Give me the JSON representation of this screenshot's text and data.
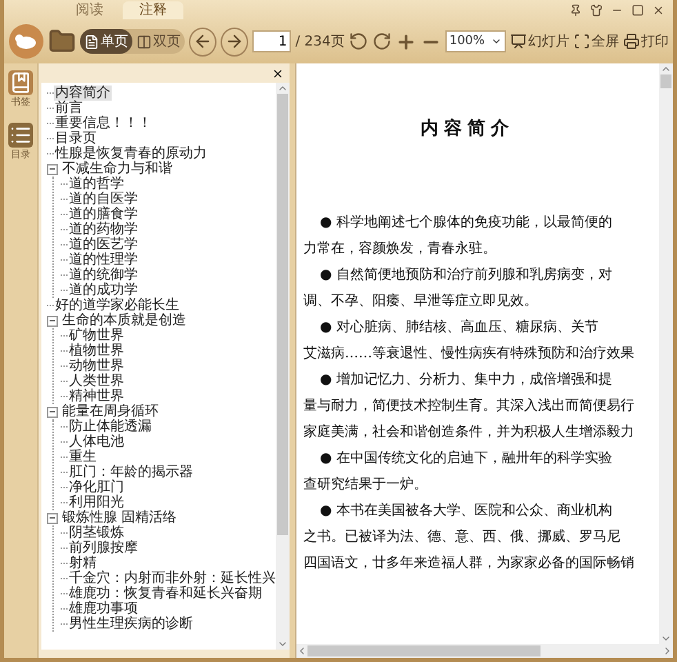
{
  "tabs": [
    {
      "label": "阅读",
      "selected": false
    },
    {
      "label": "注释",
      "selected": true
    }
  ],
  "toolbar": {
    "view_modes": [
      {
        "label": "单页",
        "kind": "single",
        "selected": true
      },
      {
        "label": "双页",
        "kind": "double",
        "selected": false
      }
    ],
    "page_input": {
      "value": "1"
    },
    "page_total": "/ 234页",
    "zoom_select": {
      "value": "100%"
    },
    "actions": [
      {
        "label": "幻灯片",
        "kind": "slideshow"
      },
      {
        "label": "全屏",
        "kind": "fullscreen"
      },
      {
        "label": "打印",
        "kind": "print"
      }
    ]
  },
  "side_rail": [
    {
      "label": "书签",
      "kind": "bookmark",
      "selected": false
    },
    {
      "label": "目录",
      "kind": "toc",
      "selected": true
    }
  ],
  "toc": {
    "items": [
      {
        "label": "内容简介",
        "selected": true
      },
      {
        "label": "前言",
        "selected": false
      },
      {
        "label": "重要信息！！！",
        "selected": false
      },
      {
        "label": "目录页",
        "selected": false
      },
      {
        "label": "性腺是恢复青春的原动力",
        "selected": false
      },
      {
        "label": "不减生命力与和谐",
        "selected": false,
        "expanded": true,
        "children": [
          {
            "label": "道的哲学",
            "selected": false
          },
          {
            "label": "道的自医学",
            "selected": false
          },
          {
            "label": "道的膳食学",
            "selected": false
          },
          {
            "label": "道的药物学",
            "selected": false
          },
          {
            "label": "道的医艺学",
            "selected": false
          },
          {
            "label": "道的性理学",
            "selected": false
          },
          {
            "label": "道的统御学",
            "selected": false
          },
          {
            "label": "道的成功学",
            "selected": false
          }
        ]
      },
      {
        "label": "好的道学家必能长生",
        "selected": false
      },
      {
        "label": "生命的本质就是创造",
        "selected": false,
        "expanded": true,
        "children": [
          {
            "label": "矿物世界",
            "selected": false
          },
          {
            "label": "植物世界",
            "selected": false
          },
          {
            "label": "动物世界",
            "selected": false
          },
          {
            "label": "人类世界",
            "selected": false
          },
          {
            "label": "精神世界",
            "selected": false
          }
        ]
      },
      {
        "label": "能量在周身循环",
        "selected": false,
        "expanded": true,
        "children": [
          {
            "label": "防止体能透漏",
            "selected": false
          },
          {
            "label": "人体电池",
            "selected": false
          },
          {
            "label": "重生",
            "selected": false
          },
          {
            "label": "肛门：年龄的揭示器",
            "selected": false
          },
          {
            "label": "净化肛门",
            "selected": false
          },
          {
            "label": "利用阳光",
            "selected": false
          }
        ]
      },
      {
        "label": "锻炼性腺 固精活络",
        "selected": false,
        "expanded": true,
        "children": [
          {
            "label": "阴茎锻炼",
            "selected": false
          },
          {
            "label": "前列腺按摩",
            "selected": false
          },
          {
            "label": "射精",
            "selected": false
          },
          {
            "label": "千金穴：内射而非外射：延长性兴",
            "selected": false
          },
          {
            "label": "雄鹿功：恢复青春和延长兴奋期",
            "selected": false
          },
          {
            "label": "雄鹿功事项",
            "selected": false
          },
          {
            "label": "男性生理疾病的诊断",
            "selected": false
          }
        ]
      }
    ]
  },
  "document": {
    "title": "内容简介",
    "paragraphs": [
      {
        "lines": [
          "● 科学地阐述七个腺体的免疫功能，以最简便的",
          "力常在，容颜焕发，青春永驻。"
        ]
      },
      {
        "lines": [
          "● 自然简便地预防和治疗前列腺和乳房病变，对",
          "调、不孕、阳痿、早泄等症立即见效。"
        ]
      },
      {
        "lines": [
          "● 对心脏病、肺结核、高血压、糖尿病、关节",
          "艾滋病……等衰退性、慢性病疾有特殊预防和治疗效果"
        ]
      },
      {
        "lines": [
          "● 增加记忆力、分析力、集中力，成倍增强和提",
          "量与耐力，简便技术控制生育。其深入浅出而简便易行",
          "家庭美满，社会和谐创造条件，并为积极人生增添毅力"
        ]
      },
      {
        "lines": [
          "● 在中国传统文化的启迪下，融卅年的科学实验",
          "查研究结果于一炉。"
        ]
      },
      {
        "lines": [
          "● 本书在美国被各大学、医院和公众、商业机构",
          "之书。已被译为法、德、意、西、俄、挪威、罗马尼",
          "四国语文，廿多年来造福人群，为家家必备的国际畅销"
        ]
      }
    ]
  }
}
